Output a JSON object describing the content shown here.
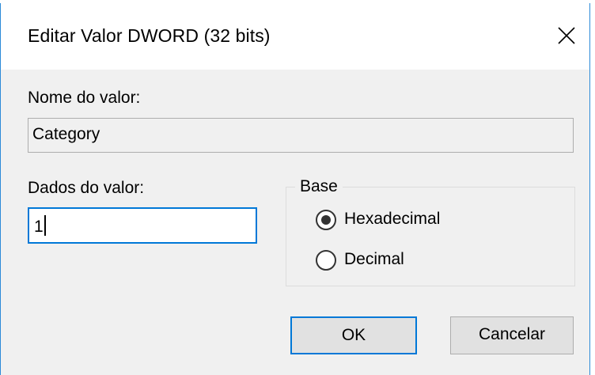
{
  "window": {
    "title": "Editar Valor DWORD (32 bits)",
    "close_icon": "close-icon",
    "accent_color": "#0078d7"
  },
  "value_name": {
    "label": "Nome do valor:",
    "value": "Category"
  },
  "value_data": {
    "label": "Dados do valor:",
    "value": "1"
  },
  "base": {
    "title": "Base",
    "options": [
      {
        "label": "Hexadecimal",
        "selected": true
      },
      {
        "label": "Decimal",
        "selected": false
      }
    ]
  },
  "buttons": {
    "ok": "OK",
    "cancel": "Cancelar"
  }
}
